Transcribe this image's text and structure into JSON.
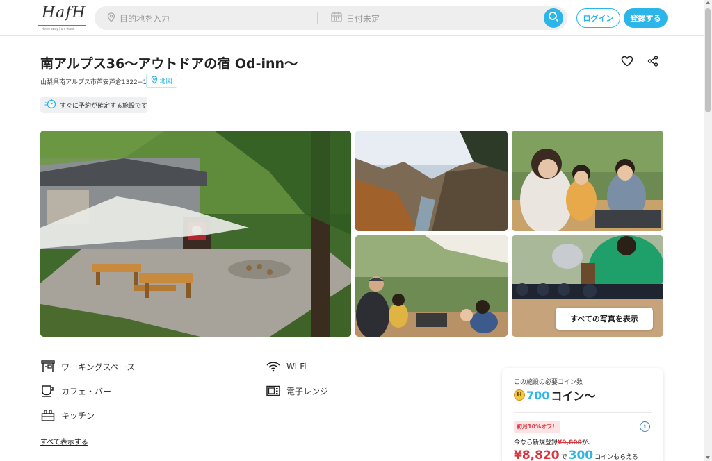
{
  "header": {
    "logo_text": "HafH",
    "logo_tagline": "Home away from Home",
    "search_place_placeholder": "目的地を入力",
    "search_date_placeholder": "日付未定",
    "login_label": "ログイン",
    "register_label": "登録する",
    "accent_color": "#2bb5e8"
  },
  "listing": {
    "title": "南アルプス36〜アウトドアの宿 Od-inn〜",
    "address": "山梨県南アルプス市芦安芦倉1322−1",
    "map_label": "地図",
    "instant_booking_label": "すぐに予約が確定する施設です",
    "show_all_photos_label": "すべての写真を表示"
  },
  "amenities": {
    "items": [
      {
        "label": "ワーキングスペース",
        "icon": "desk-icon"
      },
      {
        "label": "カフェ・バー",
        "icon": "cup-icon"
      },
      {
        "label": "キッチン",
        "icon": "kitchen-icon"
      },
      {
        "label": "Wi-Fi",
        "icon": "wifi-icon"
      },
      {
        "label": "電子レンジ",
        "icon": "microwave-icon"
      }
    ],
    "show_all_label": "すべて表示する"
  },
  "booking": {
    "required_coins_label": "この施設の必要コイン数",
    "coin_symbol": "H",
    "coin_amount": "700",
    "coin_unit": "コイン〜",
    "promo_badge": "初月10%オフ！",
    "promo_line_prefix": "今なら新規登録",
    "promo_original_price": "¥9,800",
    "promo_line_suffix": "が、",
    "promo_price": "¥8,820",
    "promo_price_connector": "で",
    "promo_coins": "300",
    "promo_coins_suffix": "コインもらえる"
  }
}
